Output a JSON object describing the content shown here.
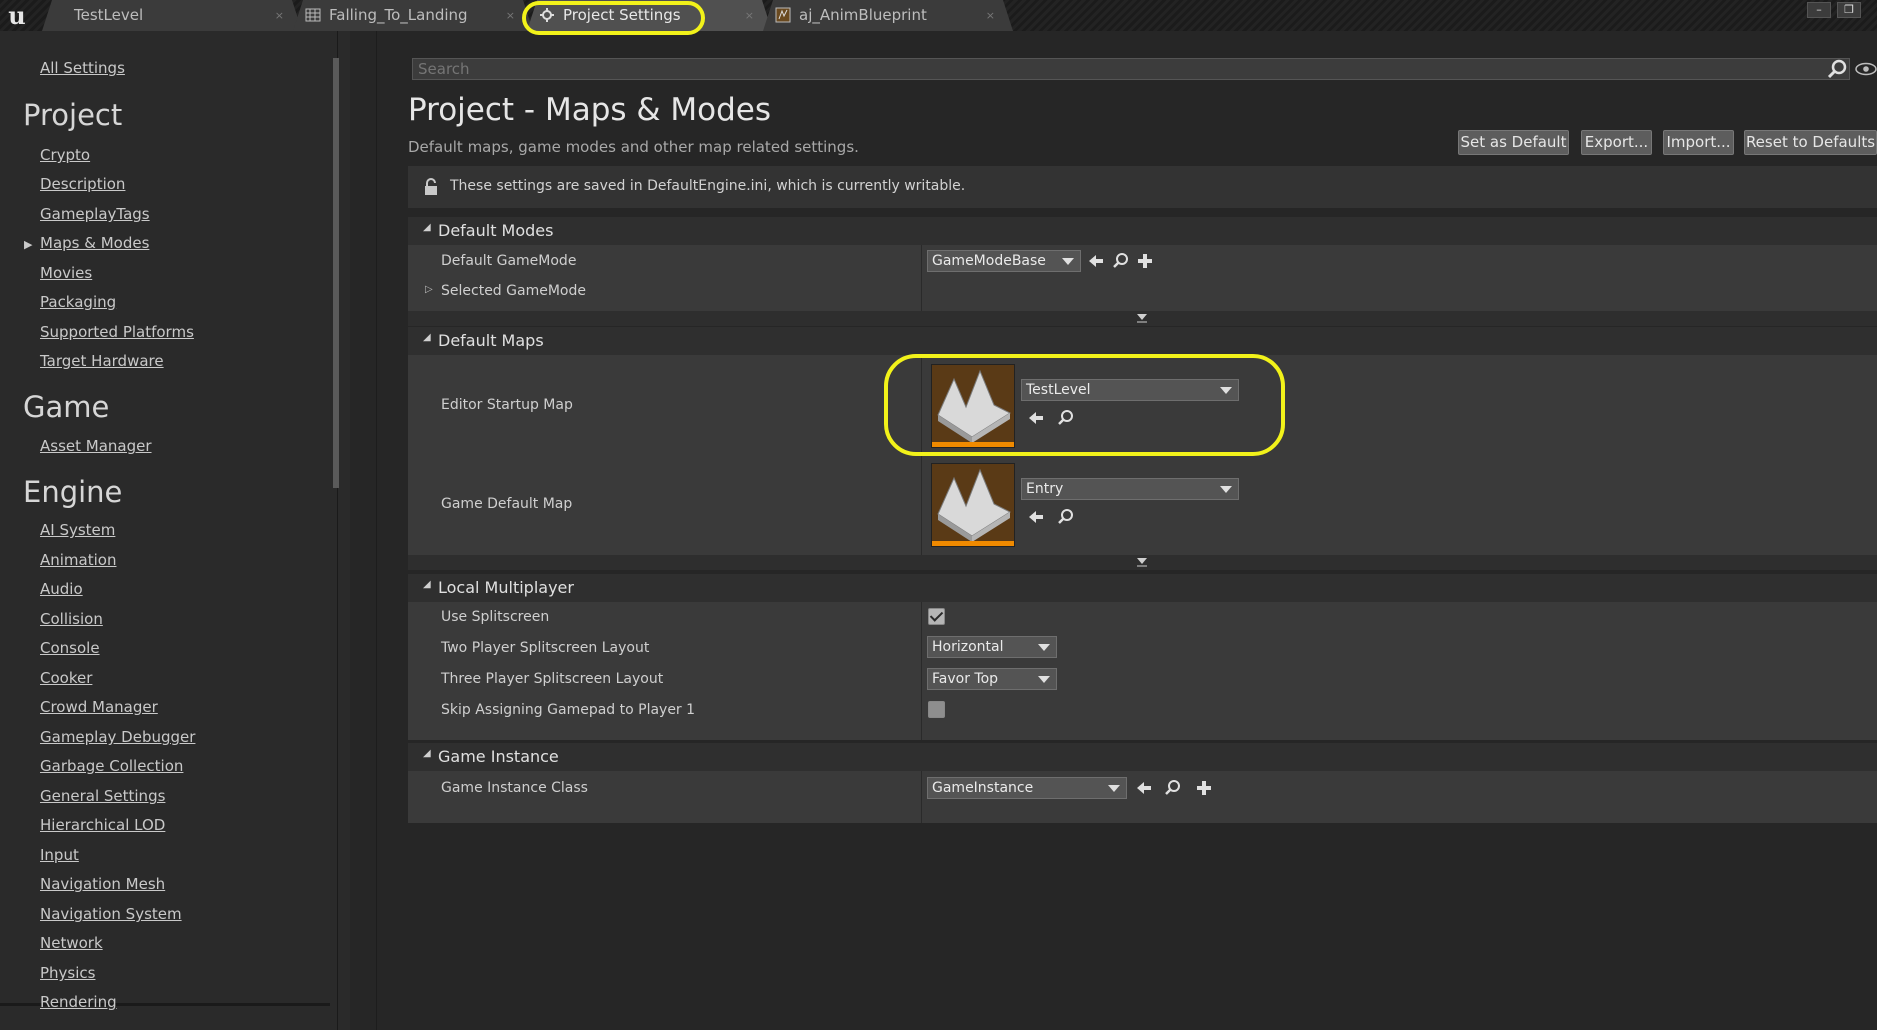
{
  "tabs": [
    {
      "label": "TestLevel",
      "icon": "level-icon",
      "active": false
    },
    {
      "label": "Falling_To_Landing",
      "icon": "animation-icon",
      "active": false
    },
    {
      "label": "Project Settings",
      "icon": "gear-icon",
      "active": true
    },
    {
      "label": "aj_AnimBlueprint",
      "icon": "blueprint-icon",
      "active": false
    }
  ],
  "sidebar": {
    "all_settings": "All Settings",
    "groups": [
      {
        "title": "Project",
        "items": [
          "Crypto",
          "Description",
          "GameplayTags",
          "Maps & Modes",
          "Movies",
          "Packaging",
          "Supported Platforms",
          "Target Hardware"
        ],
        "selected": "Maps & Modes"
      },
      {
        "title": "Game",
        "items": [
          "Asset Manager"
        ]
      },
      {
        "title": "Engine",
        "items": [
          "AI System",
          "Animation",
          "Audio",
          "Collision",
          "Console",
          "Cooker",
          "Crowd Manager",
          "Gameplay Debugger",
          "Garbage Collection",
          "General Settings",
          "Hierarchical LOD",
          "Input",
          "Navigation Mesh",
          "Navigation System",
          "Network",
          "Physics",
          "Rendering"
        ]
      }
    ]
  },
  "search": {
    "placeholder": "Search"
  },
  "header": {
    "title": "Project - Maps & Modes",
    "subtitle": "Default maps, game modes and other map related settings.",
    "buttons": {
      "set_default": "Set as Default",
      "export": "Export...",
      "import": "Import...",
      "reset": "Reset to Defaults"
    }
  },
  "notice": "These settings are saved in DefaultEngine.ini, which is currently writable.",
  "sections": {
    "default_modes": {
      "title": "Default Modes",
      "default_gamemode_label": "Default GameMode",
      "default_gamemode_value": "GameModeBase",
      "selected_gamemode_label": "Selected GameMode"
    },
    "default_maps": {
      "title": "Default Maps",
      "editor_startup_label": "Editor Startup Map",
      "editor_startup_value": "TestLevel",
      "game_default_label": "Game Default Map",
      "game_default_value": "Entry"
    },
    "local_multiplayer": {
      "title": "Local Multiplayer",
      "use_splitscreen_label": "Use Splitscreen",
      "use_splitscreen_checked": true,
      "two_player_label": "Two Player Splitscreen Layout",
      "two_player_value": "Horizontal",
      "three_player_label": "Three Player Splitscreen Layout",
      "three_player_value": "Favor Top",
      "skip_gamepad_label": "Skip Assigning Gamepad to Player 1",
      "skip_gamepad_checked": false
    },
    "game_instance": {
      "title": "Game Instance",
      "class_label": "Game Instance Class",
      "class_value": "GameInstance"
    }
  },
  "colors": {
    "highlight": "#f2f21a",
    "accent_orange": "#f08a00"
  }
}
